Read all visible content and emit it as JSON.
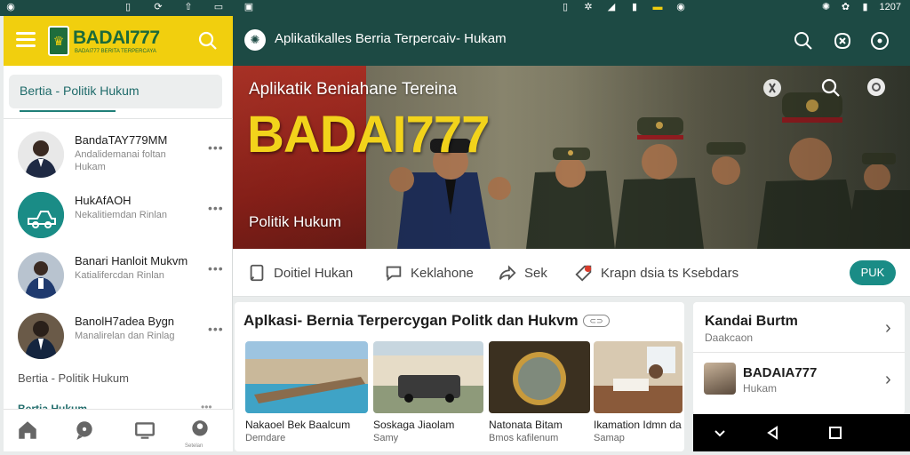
{
  "status_bar": {
    "time": "1207"
  },
  "left_panel": {
    "brand": "BADAI777",
    "brand_tagline": "BADAI777 BERITA TERPERCAYA",
    "category_pill": "Bertia - Politik Hukum",
    "items": [
      {
        "title": "BandaTAY779MM",
        "subtitle": "Andalidemanai foltan Hukam"
      },
      {
        "title": "HukAfAOH",
        "subtitle": "Nekalitiemdan Rinlan"
      },
      {
        "title": "Banari Hanloit Mukvm",
        "subtitle": "Katialifercdan Rinlan"
      },
      {
        "title": "BanolH7adea Bygn",
        "subtitle": "Manalirelan dan Rinlag"
      }
    ],
    "footer_text": "Bertia - Politik Hukum",
    "footer_text2": "Bertia Hukum",
    "bottom_nav_label": "Setelan"
  },
  "app_bar": {
    "title": "Aplikatikalles Berria Terpercaiv- Hukam"
  },
  "hero": {
    "subtitle": "Aplikatik Beniahane Tereina",
    "title": "BADAI777",
    "caption": "Politik Hukum"
  },
  "actions": {
    "a1": "Doitiel Hukan",
    "a2": "Keklahone",
    "a3": "Sek",
    "a4": "Krapn dsia ts Ksebdars",
    "pill": "PUK"
  },
  "cards_section": {
    "title": "Aplkasi- Bernia Terpercygan Politk dan Hukvm",
    "badge": "⊂⊃",
    "cards": [
      {
        "title": "Nakaoel Bek Baalcum",
        "subtitle": "Demdare"
      },
      {
        "title": "Soskaga Jiaolam",
        "subtitle": "Samy"
      },
      {
        "title": "Natonata Bitam",
        "subtitle": "Bmos kafilenum"
      },
      {
        "title": "Ikamation Idmn da",
        "subtitle": "Samap"
      }
    ]
  },
  "side_card": {
    "title": "Kandai Burtm",
    "subtitle": "Daakcaon",
    "item_title": "BADAIA777",
    "item_subtitle": "Hukam"
  },
  "colors": {
    "appbar": "#1d4a44",
    "brand_yellow": "#f1cf0e",
    "accent_teal": "#1a8c86"
  }
}
